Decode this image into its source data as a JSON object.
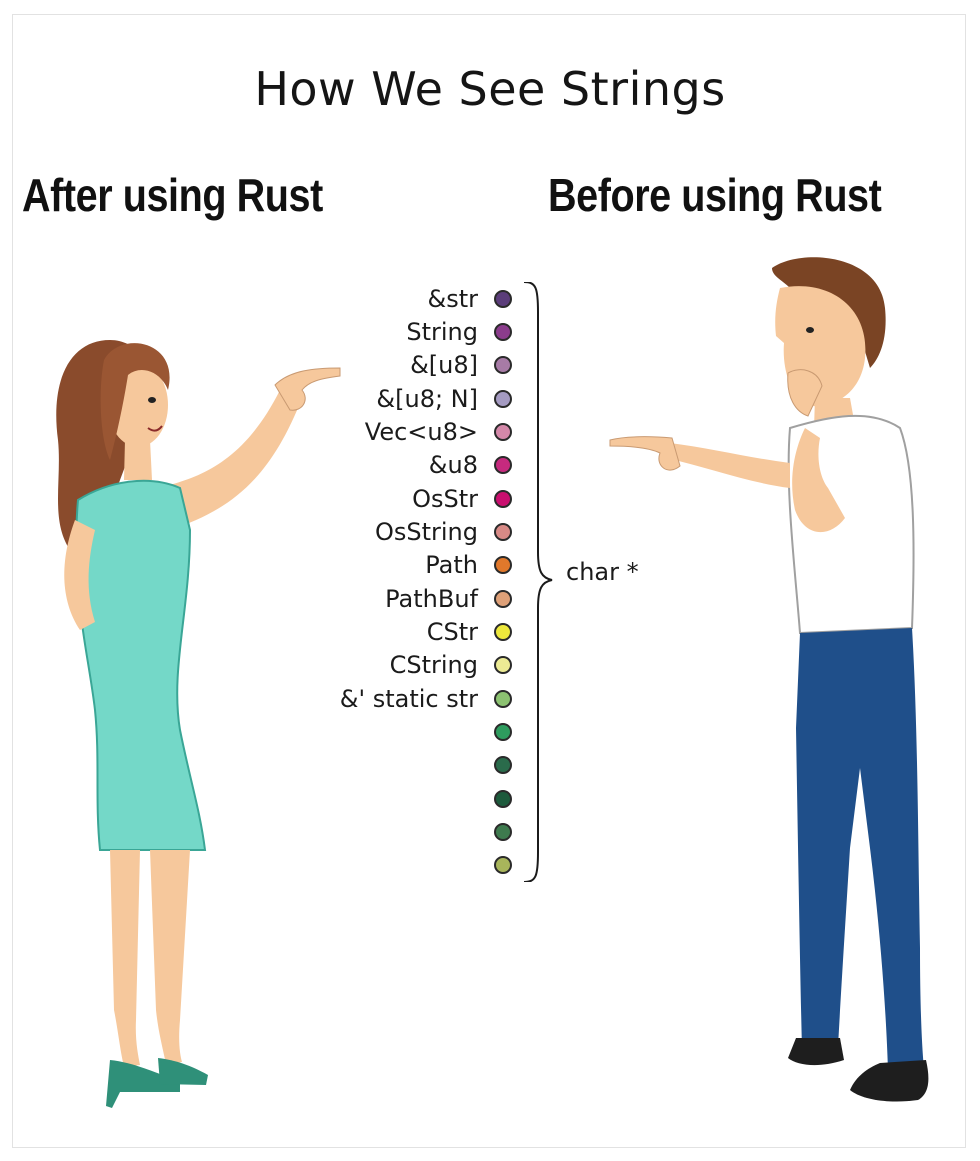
{
  "title": "How We See Strings",
  "headings": {
    "left": "After using Rust",
    "right": "Before using Rust"
  },
  "types": [
    {
      "label": "&str",
      "color": "#5b3d7a"
    },
    {
      "label": "String",
      "color": "#8b3c8c"
    },
    {
      "label": "&[u8]",
      "color": "#a77ba6"
    },
    {
      "label": "&[u8; N]",
      "color": "#a59bc2"
    },
    {
      "label": "Vec<u8>",
      "color": "#d488a9"
    },
    {
      "label": "&u8",
      "color": "#c62a7e"
    },
    {
      "label": "OsStr",
      "color": "#c90f6f"
    },
    {
      "label": "OsString",
      "color": "#d88a86"
    },
    {
      "label": "Path",
      "color": "#e0782b"
    },
    {
      "label": "PathBuf",
      "color": "#dea078"
    },
    {
      "label": "CStr",
      "color": "#ede83c"
    },
    {
      "label": "CString",
      "color": "#eceb94"
    },
    {
      "label": "&' static str",
      "color": "#8cc271"
    }
  ],
  "extra_dots": [
    {
      "color": "#2e9c5e"
    },
    {
      "color": "#2a6b4b"
    },
    {
      "color": "#1d5a3c"
    },
    {
      "color": "#3e7a4e"
    },
    {
      "color": "#a8b55b"
    }
  ],
  "brace_label": "char *",
  "colors": {
    "dress": "#74d8c8",
    "shoes": "#2f9079",
    "hair_woman": "#8a4b2c",
    "hair_man": "#7a4424",
    "skin": "#f6c89c",
    "shirt": "#ffffff",
    "jeans": "#1f4f8a",
    "man_shoes": "#1e1e1e"
  }
}
